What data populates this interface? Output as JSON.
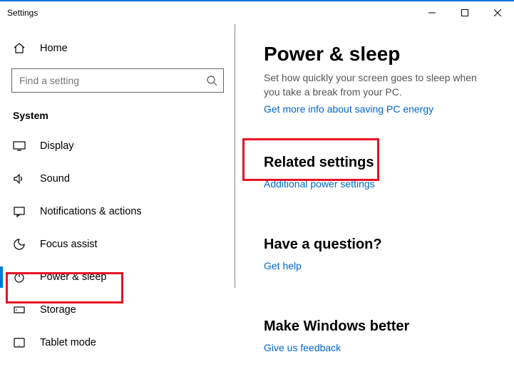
{
  "window": {
    "title": "Settings"
  },
  "sidebar": {
    "home_label": "Home",
    "search_placeholder": "Find a setting",
    "section_label": "System",
    "items": [
      {
        "label": "Display",
        "icon": "display"
      },
      {
        "label": "Sound",
        "icon": "sound"
      },
      {
        "label": "Notifications & actions",
        "icon": "notifications"
      },
      {
        "label": "Focus assist",
        "icon": "focus"
      },
      {
        "label": "Power & sleep",
        "icon": "power",
        "active": true
      },
      {
        "label": "Storage",
        "icon": "storage"
      },
      {
        "label": "Tablet mode",
        "icon": "tablet"
      }
    ]
  },
  "main": {
    "title": "Power & sleep",
    "description": "Set how quickly your screen goes to sleep when you take a break from your PC.",
    "link_more_info": "Get more info about saving PC energy",
    "related_heading": "Related settings",
    "related_link": "Additional power settings",
    "question_heading": "Have a question?",
    "question_link": "Get help",
    "feedback_heading": "Make Windows better",
    "feedback_link": "Give us feedback"
  }
}
